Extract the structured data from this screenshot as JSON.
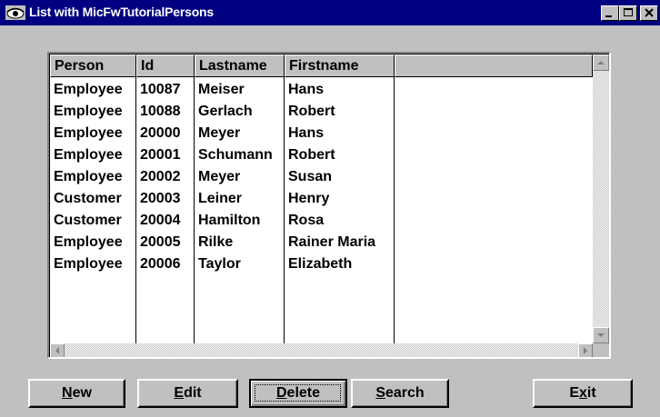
{
  "window": {
    "title": "List with MicFwTutorialPersons",
    "controls": {
      "minimize_icon": "minimize-icon",
      "maximize_icon": "maximize-icon",
      "close_icon": "close-icon"
    },
    "title_bar_color": "#000080"
  },
  "list": {
    "columns": [
      "Person",
      "Id",
      "Lastname",
      "Firstname"
    ],
    "rows": [
      [
        "Employee",
        "10087",
        "Meiser",
        "Hans"
      ],
      [
        "Employee",
        "10088",
        "Gerlach",
        "Robert"
      ],
      [
        "Employee",
        "20000",
        "Meyer",
        "Hans"
      ],
      [
        "Employee",
        "20001",
        "Schumann",
        "Robert"
      ],
      [
        "Employee",
        "20002",
        "Meyer",
        "Susan"
      ],
      [
        "Customer",
        "20003",
        "Leiner",
        "Henry"
      ],
      [
        "Customer",
        "20004",
        "Hamilton",
        "Rosa"
      ],
      [
        "Employee",
        "20005",
        "Rilke",
        "Rainer Maria"
      ],
      [
        "Employee",
        "20006",
        "Taylor",
        "Elizabeth"
      ]
    ]
  },
  "buttons": {
    "new": {
      "pre": "",
      "accel": "N",
      "post": "ew"
    },
    "edit": {
      "pre": "",
      "accel": "E",
      "post": "dit"
    },
    "delete": {
      "pre": "",
      "accel": "D",
      "post": "elete"
    },
    "search": {
      "pre": "",
      "accel": "S",
      "post": "earch"
    },
    "exit": {
      "pre": "E",
      "accel": "x",
      "post": "it"
    }
  }
}
